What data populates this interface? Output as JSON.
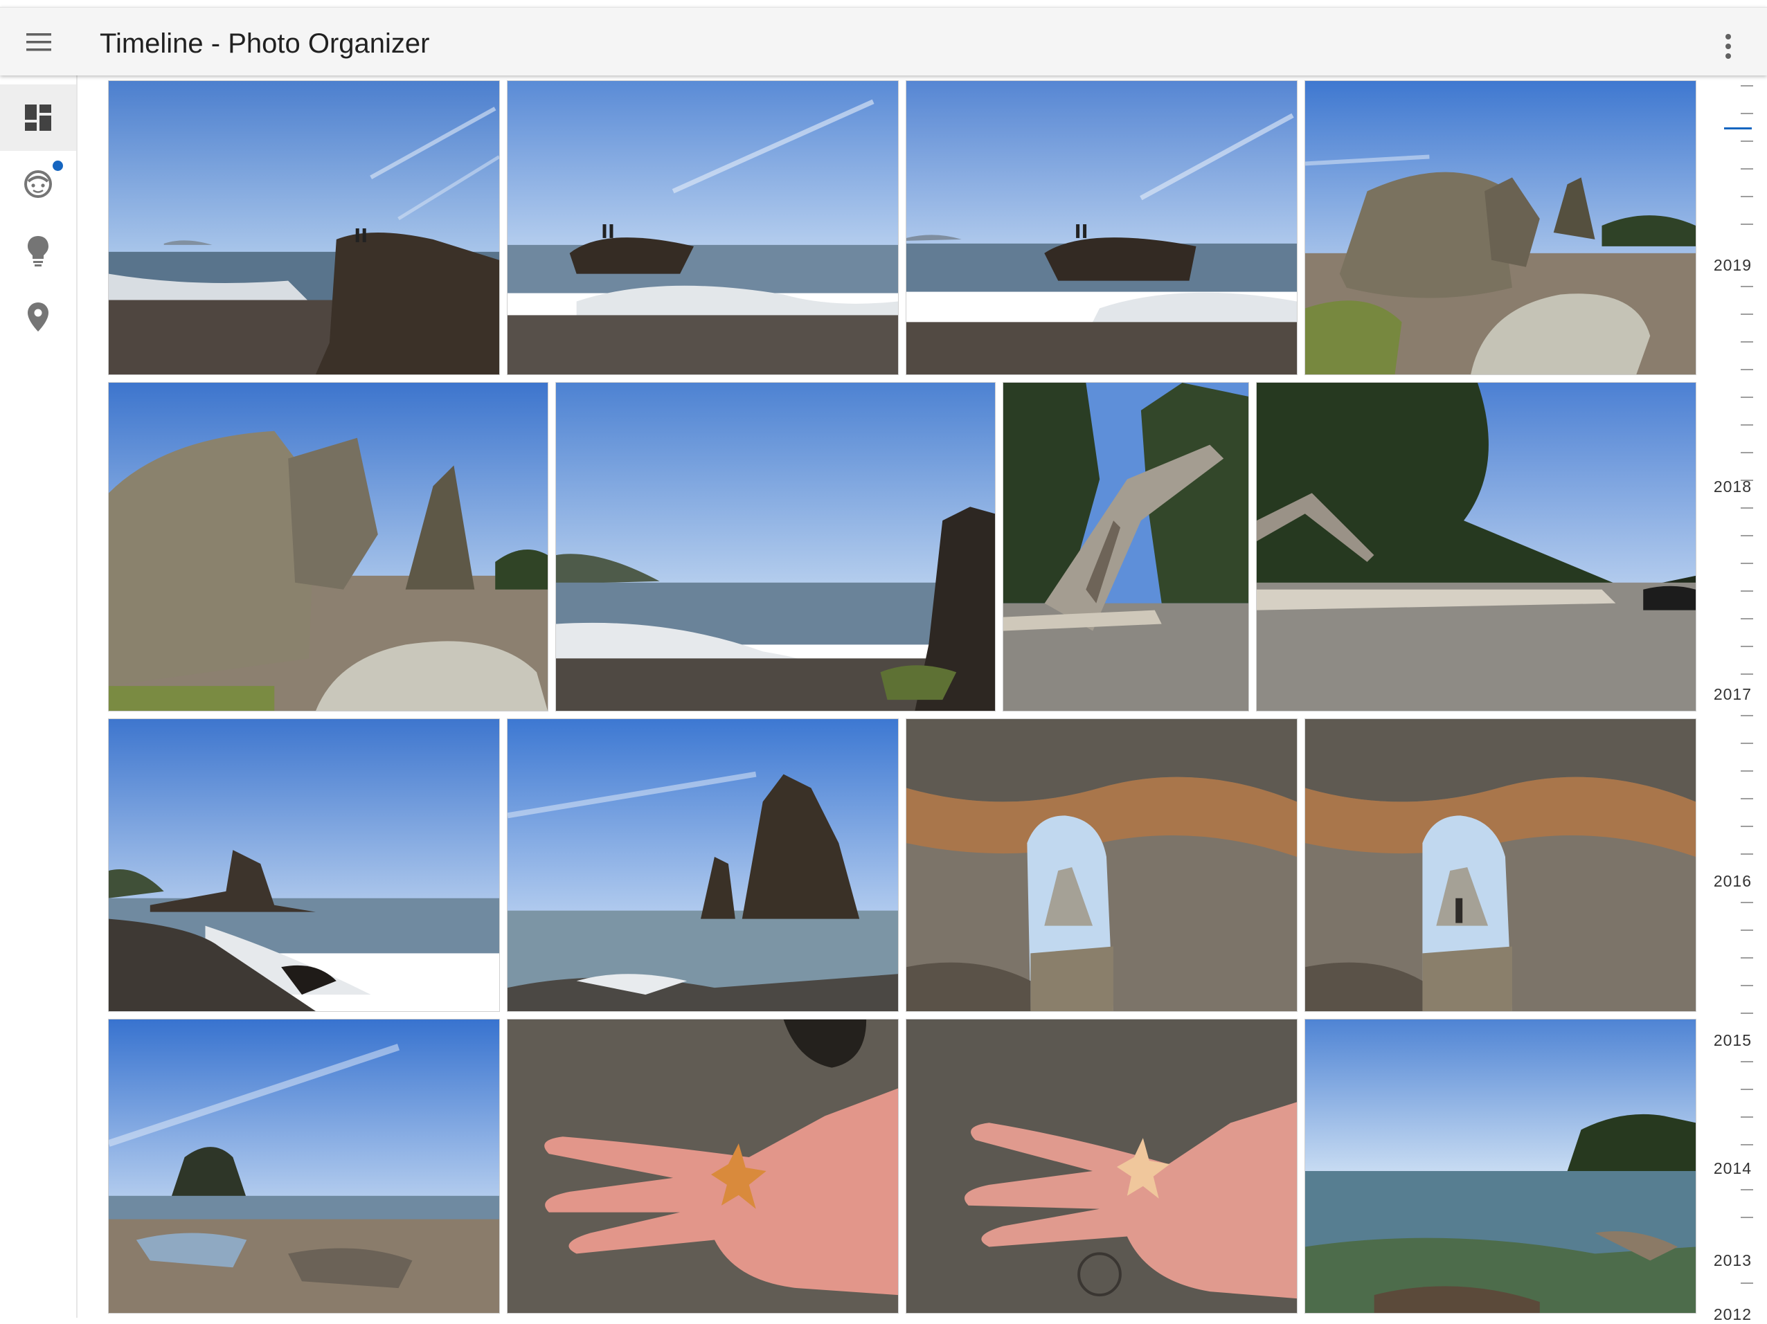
{
  "app": {
    "title": "Timeline - Photo Organizer"
  },
  "icons": {
    "menu": "menu-icon",
    "more": "more-vert-icon",
    "nav": [
      "dashboard-icon",
      "face-icon",
      "lightbulb-icon",
      "place-icon"
    ]
  },
  "colors": {
    "accent": "#1565c0",
    "topbar": "#f5f5f5",
    "nav_active": "#eeeeee"
  },
  "sidebar": {
    "items": [
      {
        "id": "timeline",
        "icon": "dashboard-icon",
        "active": true,
        "badge": false
      },
      {
        "id": "people",
        "icon": "face-icon",
        "active": false,
        "badge": true
      },
      {
        "id": "ideas",
        "icon": "lightbulb-icon",
        "active": false,
        "badge": false
      },
      {
        "id": "places",
        "icon": "place-icon",
        "active": false,
        "badge": false
      }
    ]
  },
  "photos": [
    {
      "row": 1,
      "subject": "rock-people"
    },
    {
      "row": 1,
      "subject": "rock-people"
    },
    {
      "row": 1,
      "subject": "rock-people"
    },
    {
      "row": 1,
      "subject": "boulders"
    },
    {
      "row": 2,
      "subject": "boulders"
    },
    {
      "row": 2,
      "subject": "beach-waves"
    },
    {
      "row": 2,
      "subject": "driftwood-forest"
    },
    {
      "row": 2,
      "subject": "driftwood-forest"
    },
    {
      "row": 3,
      "subject": "beach-rock"
    },
    {
      "row": 3,
      "subject": "sea-stack"
    },
    {
      "row": 3,
      "subject": "arch"
    },
    {
      "row": 3,
      "subject": "arch"
    },
    {
      "row": 4,
      "subject": "tidepools"
    },
    {
      "row": 4,
      "subject": "starfish-hand"
    },
    {
      "row": 4,
      "subject": "starfish-hand"
    },
    {
      "row": 4,
      "subject": "sea-forest"
    }
  ],
  "timeline": {
    "years": [
      "2019",
      "2018",
      "2017",
      "2016",
      "2015",
      "2014",
      "2013",
      "2012"
    ]
  }
}
